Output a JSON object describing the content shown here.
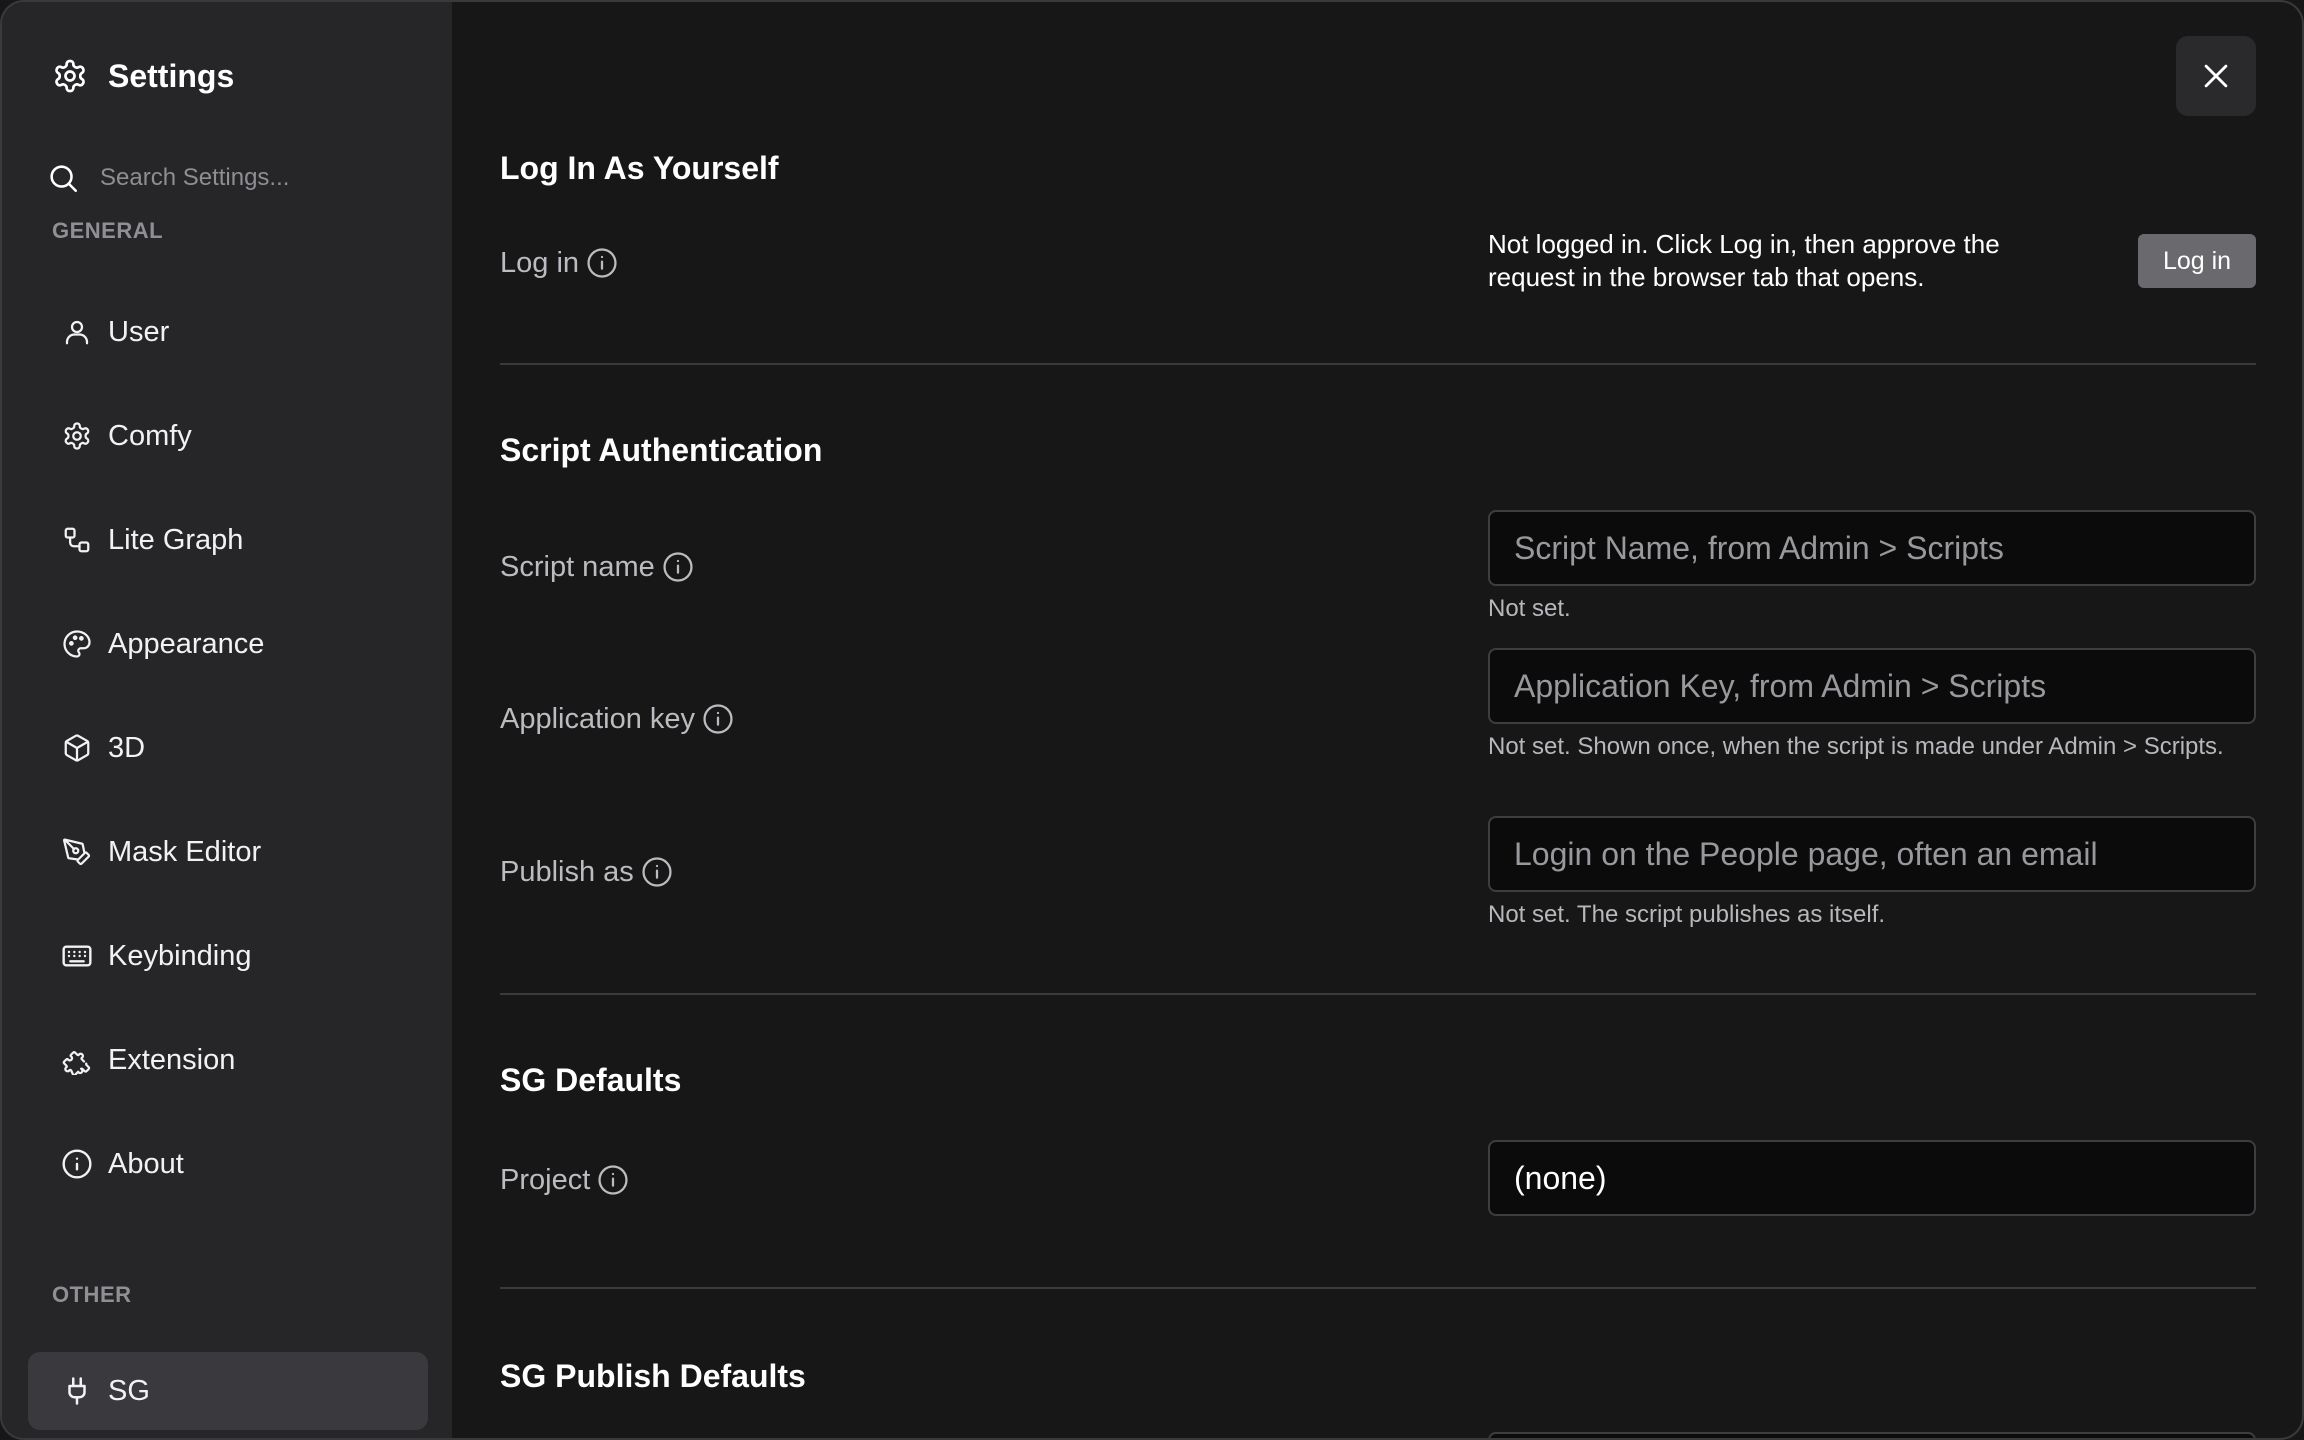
{
  "sidebar": {
    "title": "Settings",
    "search_placeholder": "Search Settings...",
    "general_label": "GENERAL",
    "other_label": "OTHER",
    "items": [
      {
        "label": "User",
        "icon": "user-icon"
      },
      {
        "label": "Comfy",
        "icon": "gear-icon"
      },
      {
        "label": "Lite Graph",
        "icon": "graph-nodes-icon"
      },
      {
        "label": "Appearance",
        "icon": "palette-icon"
      },
      {
        "label": "3D",
        "icon": "cube-icon"
      },
      {
        "label": "Mask Editor",
        "icon": "pen-tool-icon"
      },
      {
        "label": "Keybinding",
        "icon": "keyboard-icon"
      },
      {
        "label": "Extension",
        "icon": "puzzle-icon"
      },
      {
        "label": "About",
        "icon": "info-icon"
      }
    ],
    "other_items": [
      {
        "label": "SG",
        "icon": "plug-icon",
        "active": true
      }
    ]
  },
  "main": {
    "login_section": {
      "title": "Log In As Yourself",
      "login_label": "Log in",
      "status": "Not logged in. Click Log in, then approve the request in the browser tab that opens.",
      "login_button": "Log in"
    },
    "script_auth": {
      "title": "Script Authentication",
      "script_name": {
        "label": "Script name",
        "placeholder": "Script Name, from Admin > Scripts",
        "value": "",
        "hint": "Not set."
      },
      "application_key": {
        "label": "Application key",
        "placeholder": "Application Key, from Admin > Scripts",
        "value": "",
        "hint": "Not set. Shown once, when the script is made under Admin > Scripts."
      },
      "publish_as": {
        "label": "Publish as",
        "placeholder": "Login on the People page, often an email",
        "value": "",
        "hint": "Not set. The script publishes as itself."
      }
    },
    "sg_defaults": {
      "title": "SG Defaults",
      "project_label": "Project",
      "project_value": "(none)"
    },
    "sg_publish_defaults": {
      "title": "SG Publish Defaults"
    }
  }
}
